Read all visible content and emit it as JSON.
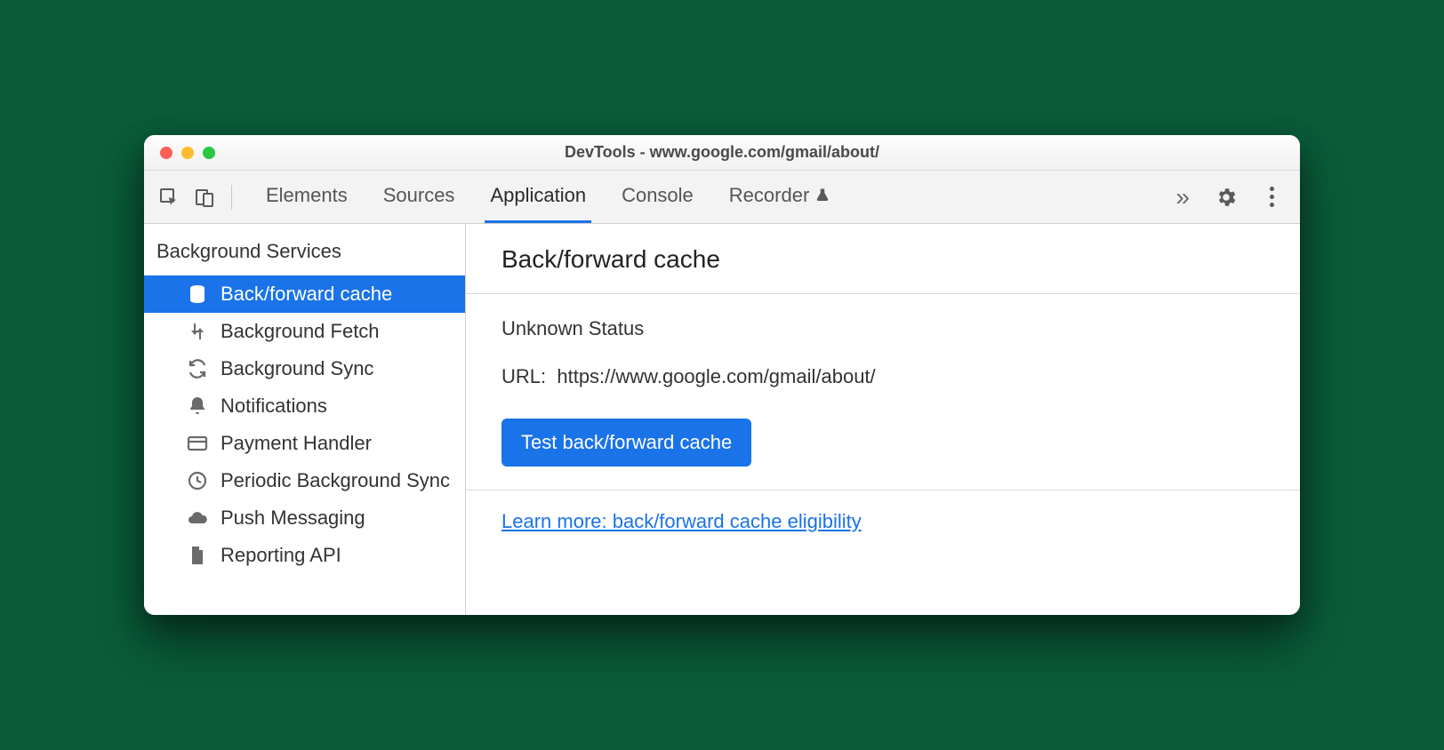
{
  "window": {
    "title": "DevTools - www.google.com/gmail/about/"
  },
  "tabs": {
    "elements": "Elements",
    "sources": "Sources",
    "application": "Application",
    "console": "Console",
    "recorder": "Recorder"
  },
  "sidebar": {
    "heading": "Background Services",
    "items": [
      {
        "label": "Back/forward cache"
      },
      {
        "label": "Background Fetch"
      },
      {
        "label": "Background Sync"
      },
      {
        "label": "Notifications"
      },
      {
        "label": "Payment Handler"
      },
      {
        "label": "Periodic Background Sync"
      },
      {
        "label": "Push Messaging"
      },
      {
        "label": "Reporting API"
      }
    ]
  },
  "main": {
    "heading": "Back/forward cache",
    "status": "Unknown Status",
    "url_label": "URL:",
    "url_value": "https://www.google.com/gmail/about/",
    "test_button": "Test back/forward cache",
    "learn_more": "Learn more: back/forward cache eligibility"
  }
}
